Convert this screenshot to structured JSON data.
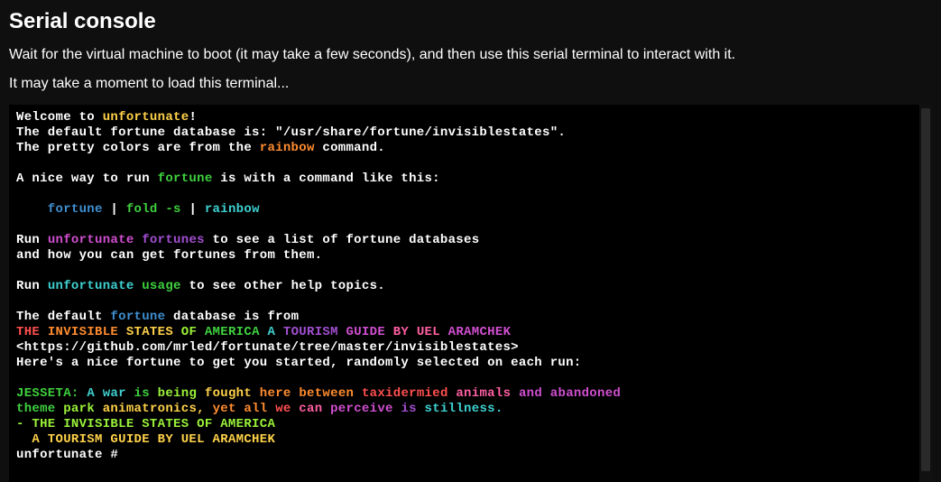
{
  "header": {
    "title": "Serial console",
    "line1": "Wait for the virtual machine to boot (it may take a few seconds), and then use this serial terminal to interact with it.",
    "line2": "It may take a moment to load this terminal..."
  },
  "terminal": {
    "tokens": [
      [
        {
          "t": "Welcome to ",
          "c": "c-white"
        },
        {
          "t": "unfortunate",
          "c": "c-yellow"
        },
        {
          "t": "!",
          "c": "c-white"
        }
      ],
      [
        {
          "t": "The default fortune database is: \"/usr/share/fortune/invisiblestates\".",
          "c": "c-white"
        }
      ],
      [
        {
          "t": "The pretty colors are from the ",
          "c": "c-white"
        },
        {
          "t": "rainbow",
          "c": "c-orange"
        },
        {
          "t": " command.",
          "c": "c-white"
        }
      ],
      [
        {
          "t": "",
          "c": "c-white"
        }
      ],
      [
        {
          "t": "A nice way to run ",
          "c": "c-white"
        },
        {
          "t": "fortune",
          "c": "c-green"
        },
        {
          "t": " is with a command like this:",
          "c": "c-white"
        }
      ],
      [
        {
          "t": "",
          "c": "c-white"
        }
      ],
      [
        {
          "t": "    fortune",
          "c": "c-blue"
        },
        {
          "t": " | ",
          "c": "c-white"
        },
        {
          "t": "fold -s",
          "c": "c-green"
        },
        {
          "t": " | ",
          "c": "c-white"
        },
        {
          "t": "rainbow",
          "c": "c-cyan"
        }
      ],
      [
        {
          "t": "",
          "c": "c-white"
        }
      ],
      [
        {
          "t": "Run ",
          "c": "c-white"
        },
        {
          "t": "unfortunate",
          "c": "c-magenta"
        },
        {
          "t": " ",
          "c": "c-white"
        },
        {
          "t": "fortunes",
          "c": "c-purple"
        },
        {
          "t": " to see a list of fortune databases",
          "c": "c-white"
        }
      ],
      [
        {
          "t": "and how you can get fortunes from them.",
          "c": "c-white"
        }
      ],
      [
        {
          "t": "",
          "c": "c-white"
        }
      ],
      [
        {
          "t": "Run ",
          "c": "c-white"
        },
        {
          "t": "unfortunate",
          "c": "c-cyan"
        },
        {
          "t": " ",
          "c": "c-white"
        },
        {
          "t": "usage",
          "c": "c-green"
        },
        {
          "t": " to see other help topics.",
          "c": "c-white"
        }
      ],
      [
        {
          "t": "",
          "c": "c-white"
        }
      ],
      [
        {
          "t": "The default ",
          "c": "c-white"
        },
        {
          "t": "fortune",
          "c": "c-blue"
        },
        {
          "t": " database is from",
          "c": "c-white"
        }
      ],
      [
        {
          "t": "THE",
          "c": "c-red"
        },
        {
          "t": " ",
          "c": "c-white"
        },
        {
          "t": "INVISIBLE",
          "c": "c-orange"
        },
        {
          "t": " ",
          "c": "c-white"
        },
        {
          "t": "STATES",
          "c": "c-yellow"
        },
        {
          "t": " ",
          "c": "c-white"
        },
        {
          "t": "OF",
          "c": "c-lime"
        },
        {
          "t": " ",
          "c": "c-white"
        },
        {
          "t": "AMERICA",
          "c": "c-green"
        },
        {
          "t": " ",
          "c": "c-white"
        },
        {
          "t": "A",
          "c": "c-cyan"
        },
        {
          "t": " ",
          "c": "c-white"
        },
        {
          "t": "TOURISM",
          "c": "c-purple"
        },
        {
          "t": " ",
          "c": "c-white"
        },
        {
          "t": "GUIDE",
          "c": "c-magenta"
        },
        {
          "t": " ",
          "c": "c-white"
        },
        {
          "t": "BY",
          "c": "c-pink"
        },
        {
          "t": " ",
          "c": "c-white"
        },
        {
          "t": "UEL",
          "c": "c-pink"
        },
        {
          "t": " ",
          "c": "c-white"
        },
        {
          "t": "ARAMCHEK",
          "c": "c-magenta"
        }
      ],
      [
        {
          "t": "<https://github.com/mrled/fortunate/tree/master/invisiblestates>",
          "c": "c-white"
        }
      ],
      [
        {
          "t": "Here's a nice fortune to get you started, randomly selected on each run:",
          "c": "c-white"
        }
      ],
      [
        {
          "t": "",
          "c": "c-white"
        }
      ],
      [
        {
          "t": "JESSETA:",
          "c": "c-green"
        },
        {
          "t": " ",
          "c": "c-white"
        },
        {
          "t": "A",
          "c": "c-cyan"
        },
        {
          "t": " ",
          "c": "c-white"
        },
        {
          "t": "war",
          "c": "c-cyan"
        },
        {
          "t": " ",
          "c": "c-white"
        },
        {
          "t": "is",
          "c": "c-green"
        },
        {
          "t": " ",
          "c": "c-white"
        },
        {
          "t": "being",
          "c": "c-lime"
        },
        {
          "t": " ",
          "c": "c-white"
        },
        {
          "t": "fought",
          "c": "c-yellow"
        },
        {
          "t": " ",
          "c": "c-white"
        },
        {
          "t": "here",
          "c": "c-orange"
        },
        {
          "t": " ",
          "c": "c-white"
        },
        {
          "t": "between",
          "c": "c-orange"
        },
        {
          "t": " ",
          "c": "c-white"
        },
        {
          "t": "taxidermied",
          "c": "c-red"
        },
        {
          "t": " ",
          "c": "c-white"
        },
        {
          "t": "animals",
          "c": "c-pink"
        },
        {
          "t": " ",
          "c": "c-white"
        },
        {
          "t": "and",
          "c": "c-magenta"
        },
        {
          "t": " ",
          "c": "c-white"
        },
        {
          "t": "abandoned",
          "c": "c-magenta"
        }
      ],
      [
        {
          "t": "theme",
          "c": "c-green"
        },
        {
          "t": " ",
          "c": "c-white"
        },
        {
          "t": "park",
          "c": "c-lime"
        },
        {
          "t": " ",
          "c": "c-white"
        },
        {
          "t": "animatronics,",
          "c": "c-yellow"
        },
        {
          "t": " ",
          "c": "c-white"
        },
        {
          "t": "yet",
          "c": "c-orange"
        },
        {
          "t": " ",
          "c": "c-white"
        },
        {
          "t": "all",
          "c": "c-orange"
        },
        {
          "t": " ",
          "c": "c-white"
        },
        {
          "t": "we",
          "c": "c-red"
        },
        {
          "t": " ",
          "c": "c-white"
        },
        {
          "t": "can",
          "c": "c-pink"
        },
        {
          "t": " ",
          "c": "c-white"
        },
        {
          "t": "perceive",
          "c": "c-magenta"
        },
        {
          "t": " ",
          "c": "c-white"
        },
        {
          "t": "is",
          "c": "c-purple"
        },
        {
          "t": " ",
          "c": "c-white"
        },
        {
          "t": "stillness.",
          "c": "c-cyan"
        }
      ],
      [
        {
          "t": "- THE INVISIBLE STATES OF AMERICA",
          "c": "c-lime"
        }
      ],
      [
        {
          "t": "  A TOURISM GUIDE BY UEL ARAMCHEK",
          "c": "c-yellow"
        }
      ],
      [
        {
          "t": "unfortunate # ",
          "c": "c-white"
        }
      ]
    ],
    "prompt": "unfortunate # "
  }
}
